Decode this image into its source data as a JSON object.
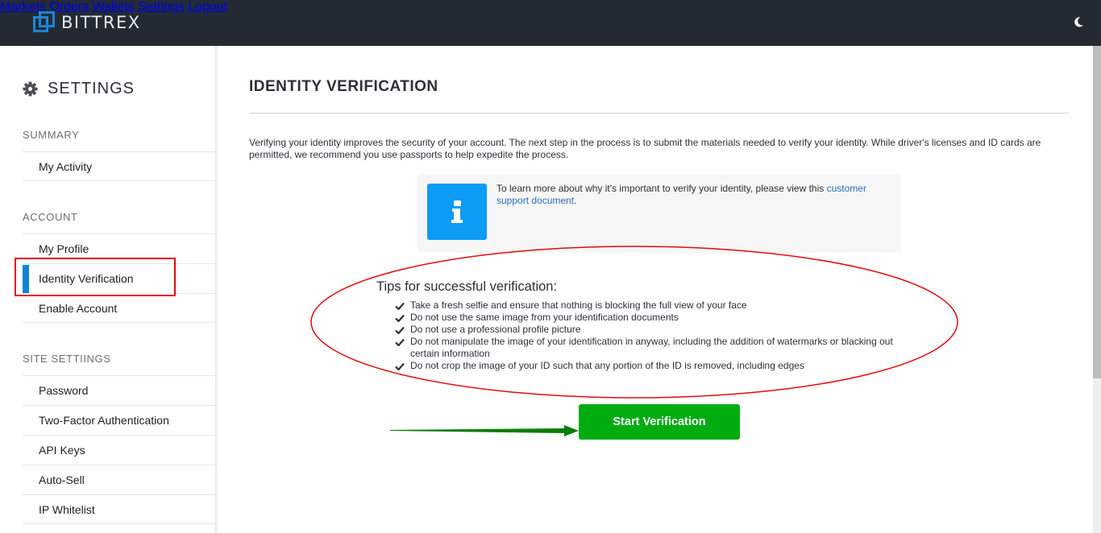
{
  "app": {
    "brand": "BITTREX",
    "accent_color": "#1b86d8",
    "nav_bg": "#232a34"
  },
  "nav": {
    "items": [
      {
        "label": "Markets"
      },
      {
        "label": "Orders"
      },
      {
        "label": "Wallets"
      },
      {
        "label": "Settings"
      },
      {
        "label": "Logout"
      }
    ],
    "theme_toggle_icon": "moon-icon"
  },
  "sidebar": {
    "title": "SETTINGS",
    "title_icon": "gear-icon",
    "sections": [
      {
        "label": "SUMMARY",
        "items": [
          {
            "label": "My Activity"
          }
        ]
      },
      {
        "label": "ACCOUNT",
        "items": [
          {
            "label": "My Profile"
          },
          {
            "label": "Identity Verification",
            "active": true
          },
          {
            "label": "Enable Account"
          }
        ]
      },
      {
        "label": "SITE SETTIINGS",
        "items": [
          {
            "label": "Password"
          },
          {
            "label": "Two-Factor Authentication"
          },
          {
            "label": "API Keys"
          },
          {
            "label": "Auto-Sell"
          },
          {
            "label": "IP Whitelist"
          }
        ]
      }
    ]
  },
  "main": {
    "title": "IDENTITY VERIFICATION",
    "intro": "Verifying your identity improves the security of your account. The next step in the process is to submit the materials needed to verify your identity. While driver's licenses and ID cards are permitted, we recommend you use passports to help expedite the process.",
    "info": {
      "icon": "info-icon",
      "text_before": "To learn more about why it's important to verify your identity, please view this ",
      "link_text": "customer support document",
      "text_after": "."
    },
    "tips": {
      "title": "Tips for successful verification:",
      "items": [
        "Take a fresh selfie and ensure that nothing is blocking the full view of your face",
        "Do not use the same image from your identification documents",
        "Do not use a professional profile picture",
        "Do not manipulate the image of your identification in anyway, including the addition of watermarks or blacking out certain information",
        "Do not crop the image of your ID such that any portion of the ID is removed, including edges"
      ]
    },
    "start_button": {
      "label": "Start Verification",
      "color": "#00ac0f"
    }
  },
  "annotations": {
    "highlight_color": "#e30b0b",
    "arrow_color": "#0a7d0a"
  }
}
